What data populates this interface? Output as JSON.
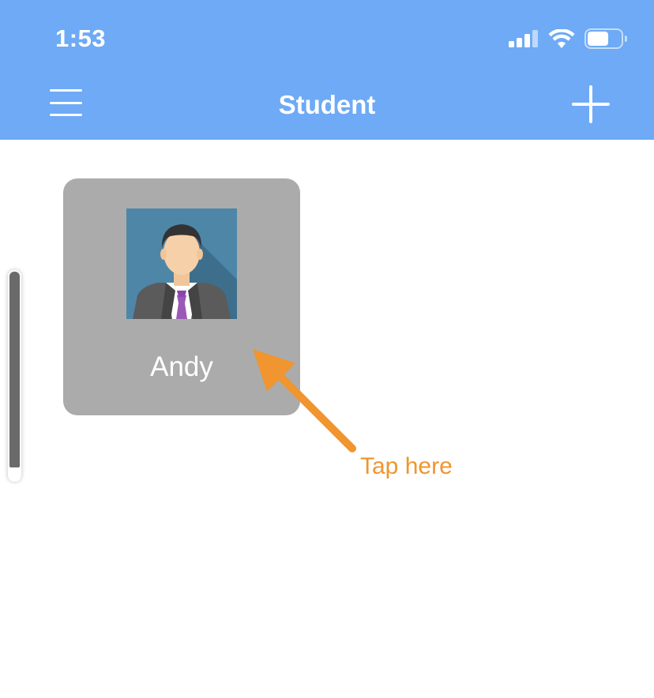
{
  "status_bar": {
    "time": "1:53",
    "icons": [
      "cellular-signal-icon",
      "wifi-icon",
      "battery-icon"
    ]
  },
  "header": {
    "title": "Student",
    "left_icon": "hamburger-menu-icon",
    "right_icon": "plus-icon",
    "background_color": "#6eaaf5"
  },
  "students": [
    {
      "name": "Andy",
      "avatar_icon": "businessman-avatar-icon"
    }
  ],
  "card_color": "#ababab",
  "scroll_indicator": {
    "level": 0.94
  },
  "annotation": {
    "text": "Tap here",
    "icon": "arrow-icon",
    "color": "#f0952f"
  }
}
